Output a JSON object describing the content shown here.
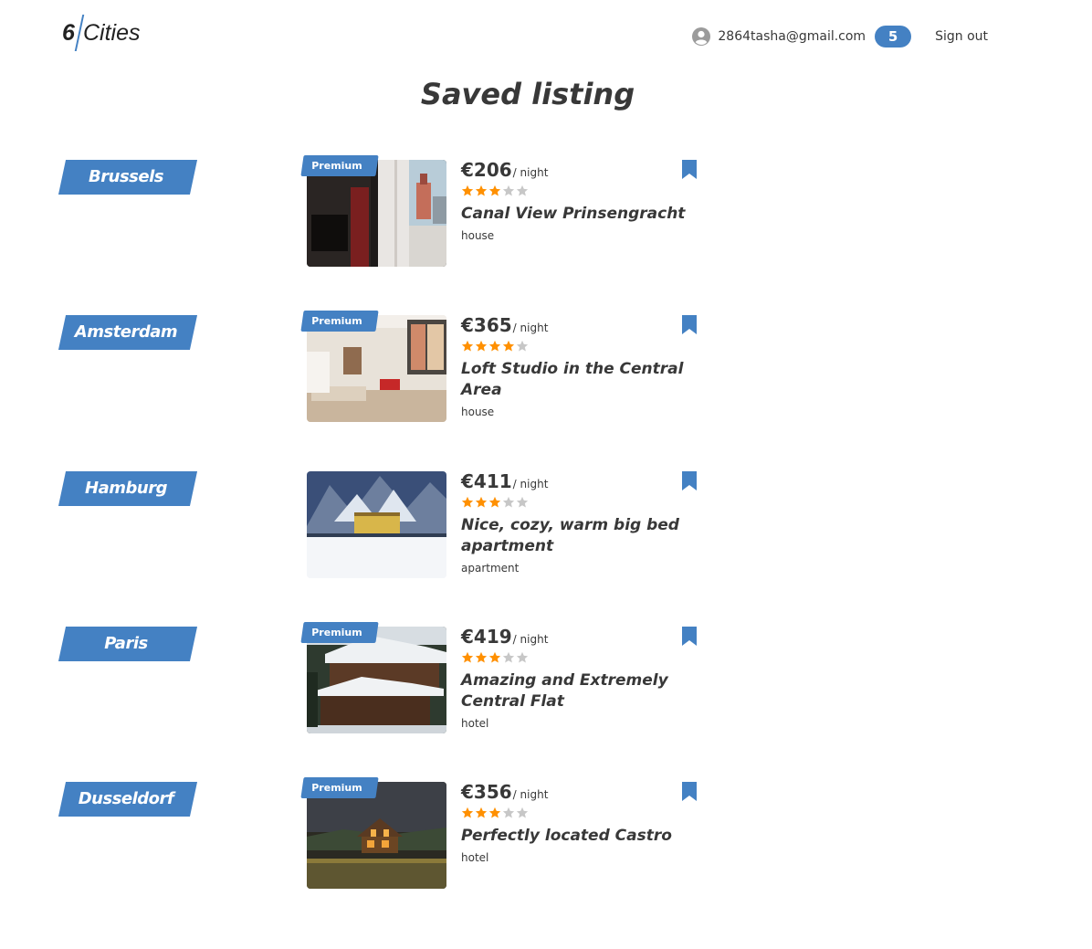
{
  "header": {
    "logo_number": "6",
    "logo_text": "Cities",
    "user_email": "2864tasha@gmail.com",
    "favorites_count": "5",
    "sign_out_label": "Sign out"
  },
  "page_title": "Saved listing",
  "colors": {
    "accent": "#4481c3",
    "star_filled": "#ff9000",
    "star_empty": "#c7c7c7"
  },
  "locations": [
    {
      "city": "Brussels",
      "premium": true,
      "premium_label": "Premium",
      "price": "€206",
      "per_night": "/ night",
      "rating": 3,
      "title": "Canal View Prinsengracht",
      "type": "house"
    },
    {
      "city": "Amsterdam",
      "premium": true,
      "premium_label": "Premium",
      "price": "€365",
      "per_night": "/ night",
      "rating": 4,
      "title": "Loft Studio in the Central Area",
      "type": "house"
    },
    {
      "city": "Hamburg",
      "premium": false,
      "premium_label": "",
      "price": "€411",
      "per_night": "/ night",
      "rating": 3,
      "title": "Nice, cozy, warm big bed apartment",
      "type": "apartment"
    },
    {
      "city": "Paris",
      "premium": true,
      "premium_label": "Premium",
      "price": "€419",
      "per_night": "/ night",
      "rating": 3,
      "title": "Amazing and Extremely Central Flat",
      "type": "hotel"
    },
    {
      "city": "Dusseldorf",
      "premium": true,
      "premium_label": "Premium",
      "price": "€356",
      "per_night": "/ night",
      "rating": 3,
      "title": "Perfectly located Castro",
      "type": "hotel"
    }
  ]
}
